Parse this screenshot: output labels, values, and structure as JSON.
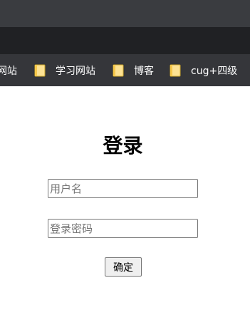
{
  "bookmarks": [
    {
      "label": "网站",
      "icon": "folder-icon"
    },
    {
      "label": "学习网站",
      "icon": "folder-icon"
    },
    {
      "label": "博客",
      "icon": "folder-icon"
    },
    {
      "label": "cug+四级",
      "icon": "folder-icon"
    }
  ],
  "login": {
    "title": "登录",
    "username_placeholder": "用户名",
    "username_value": "",
    "password_placeholder": "登录密码",
    "password_value": "",
    "submit_label": "确定"
  },
  "colors": {
    "browser_chrome": "#3a3c40",
    "address_strip": "#202124",
    "bookmarks_bar": "#35363a",
    "folder": "#fde293",
    "page_bg": "#ffffff"
  }
}
